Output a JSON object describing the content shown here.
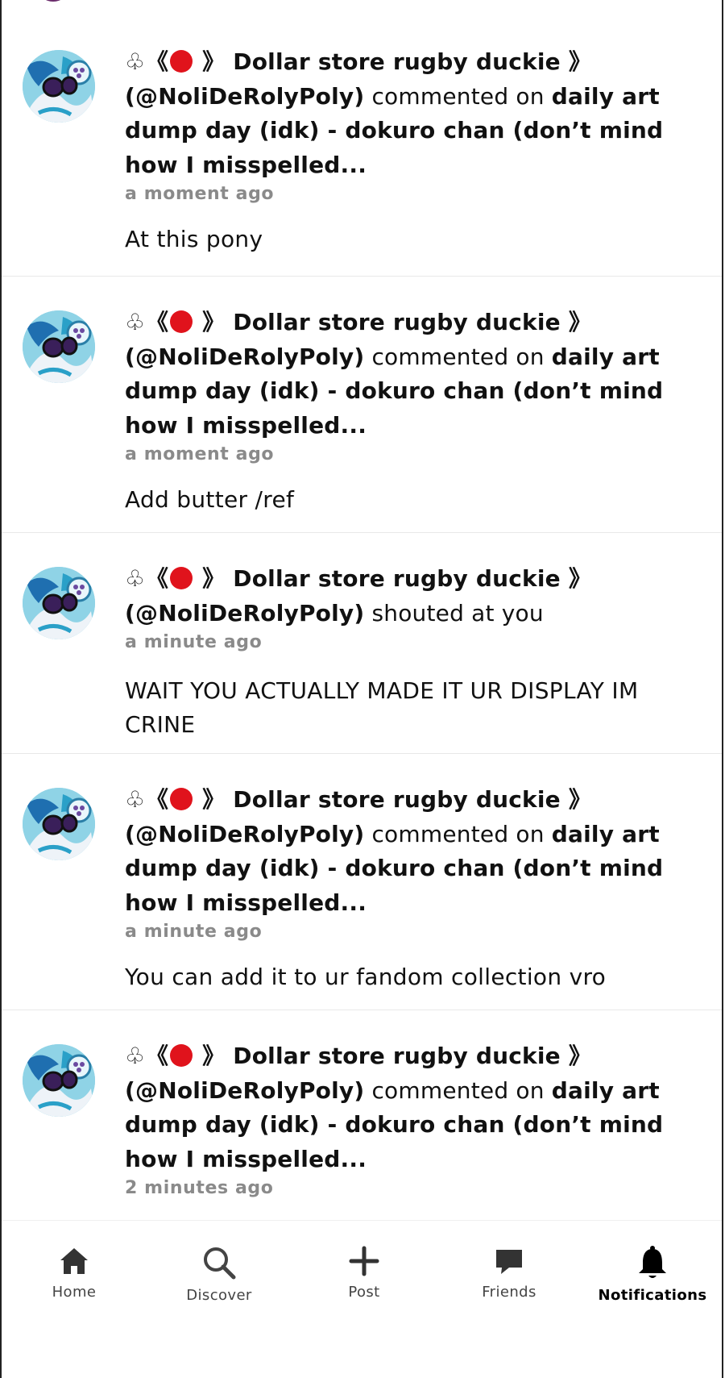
{
  "notifications": [
    {
      "prefix": "♧ 《",
      "user_display": "》 Dollar store rugby duckie 》",
      "handle": "(@NoliDeRolyPoly)",
      "action": " commented on ",
      "target": "daily art dump day (idk) - dokuro chan (don’t mind how I misspelled...",
      "time": "a moment ago",
      "message": "At this pony"
    },
    {
      "prefix": "♧ 《",
      "user_display": "》 Dollar store rugby duckie 》",
      "handle": "(@NoliDeRolyPoly)",
      "action": " commented on ",
      "target": "daily art dump day (idk) - dokuro chan (don’t mind how I misspelled...",
      "time": "a moment ago",
      "message": "Add butter /ref"
    },
    {
      "prefix": "♧ 《",
      "user_display": "》 Dollar store rugby duckie 》",
      "handle": "(@NoliDeRolyPoly)",
      "action": " shouted at you",
      "target": "",
      "time": "a minute ago",
      "message": "WAIT YOU ACTUALLY MADE IT UR DISPLAY IM CRINE"
    },
    {
      "prefix": "♧ 《",
      "user_display": "》 Dollar store rugby duckie 》",
      "handle": "(@NoliDeRolyPoly)",
      "action": " commented on ",
      "target": "daily art dump day (idk) - dokuro chan (don’t mind how I misspelled...",
      "time": "a minute ago",
      "message": "You can add it to ur fandom collection vro"
    },
    {
      "prefix": "♧ 《",
      "user_display": "》 Dollar store rugby duckie 》",
      "handle": "(@NoliDeRolyPoly)",
      "action": " commented on ",
      "target": "daily art dump day (idk) - dokuro chan (don’t mind how I misspelled...",
      "time": "2 minutes ago",
      "message": ""
    }
  ],
  "tabbar": {
    "home": "Home",
    "discover": "Discover",
    "post": "Post",
    "friends": "Friends",
    "notifications": "Notifications",
    "active": "notifications"
  },
  "icons": [
    "home-icon",
    "search-icon",
    "plus-icon",
    "chat-bubble-icon",
    "bell-icon"
  ],
  "colors": {
    "status_dot": "#e0131c",
    "timestamp": "#8a8a8a",
    "divider": "#e8e8e8"
  }
}
